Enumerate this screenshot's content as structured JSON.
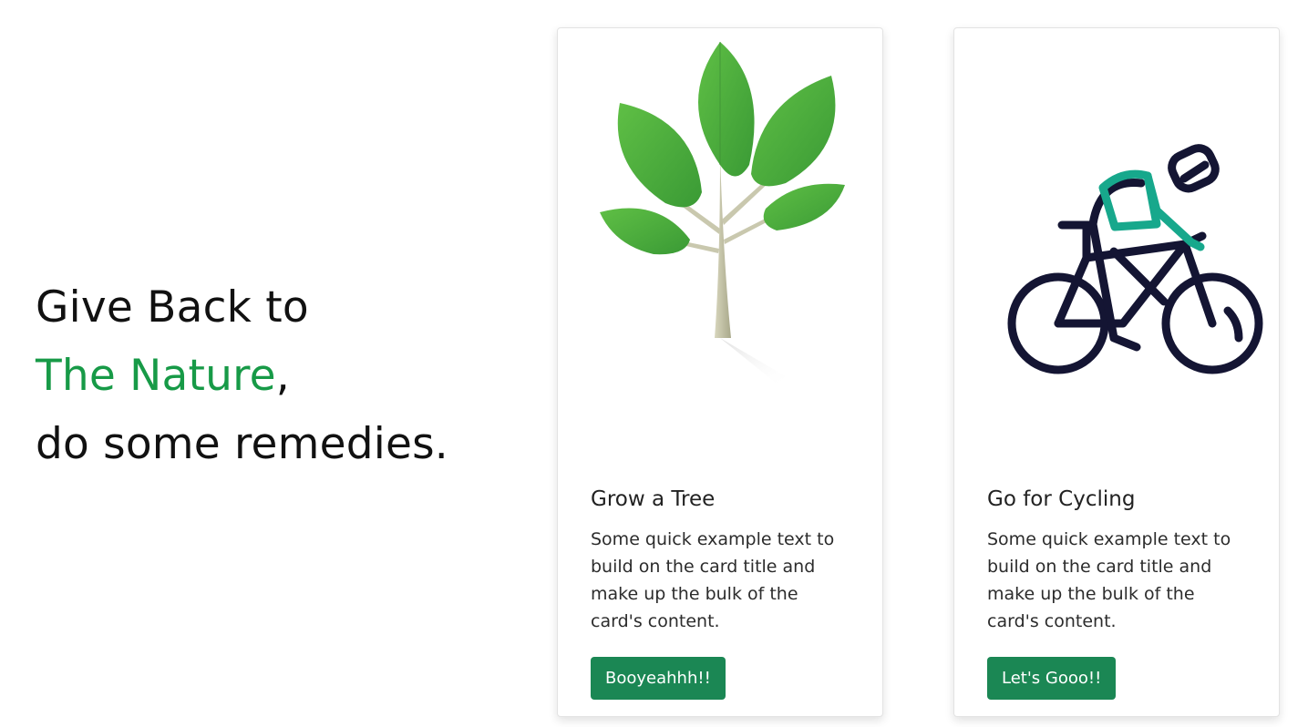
{
  "hero": {
    "line1": "Give Back to",
    "highlight": "The Nature",
    "comma": ",",
    "line3": "do some remedies.",
    "highlight_color": "#179a47"
  },
  "cards": [
    {
      "illustration": "tree-illustration",
      "title": "Grow a Tree",
      "text": "Some quick example text to build on the card title and make up the bulk of the card's content.",
      "button": "Booyeahhh!!"
    },
    {
      "illustration": "cyclist-illustration",
      "title": "Go for Cycling",
      "text": "Some quick example text to build on the card title and make up the bulk of the card's content.",
      "button": "Let's Gooo!!"
    }
  ],
  "colors": {
    "button": "#1b8754",
    "leaf": "#4fae3f",
    "bike": "#141533",
    "jersey": "#17a88c"
  }
}
